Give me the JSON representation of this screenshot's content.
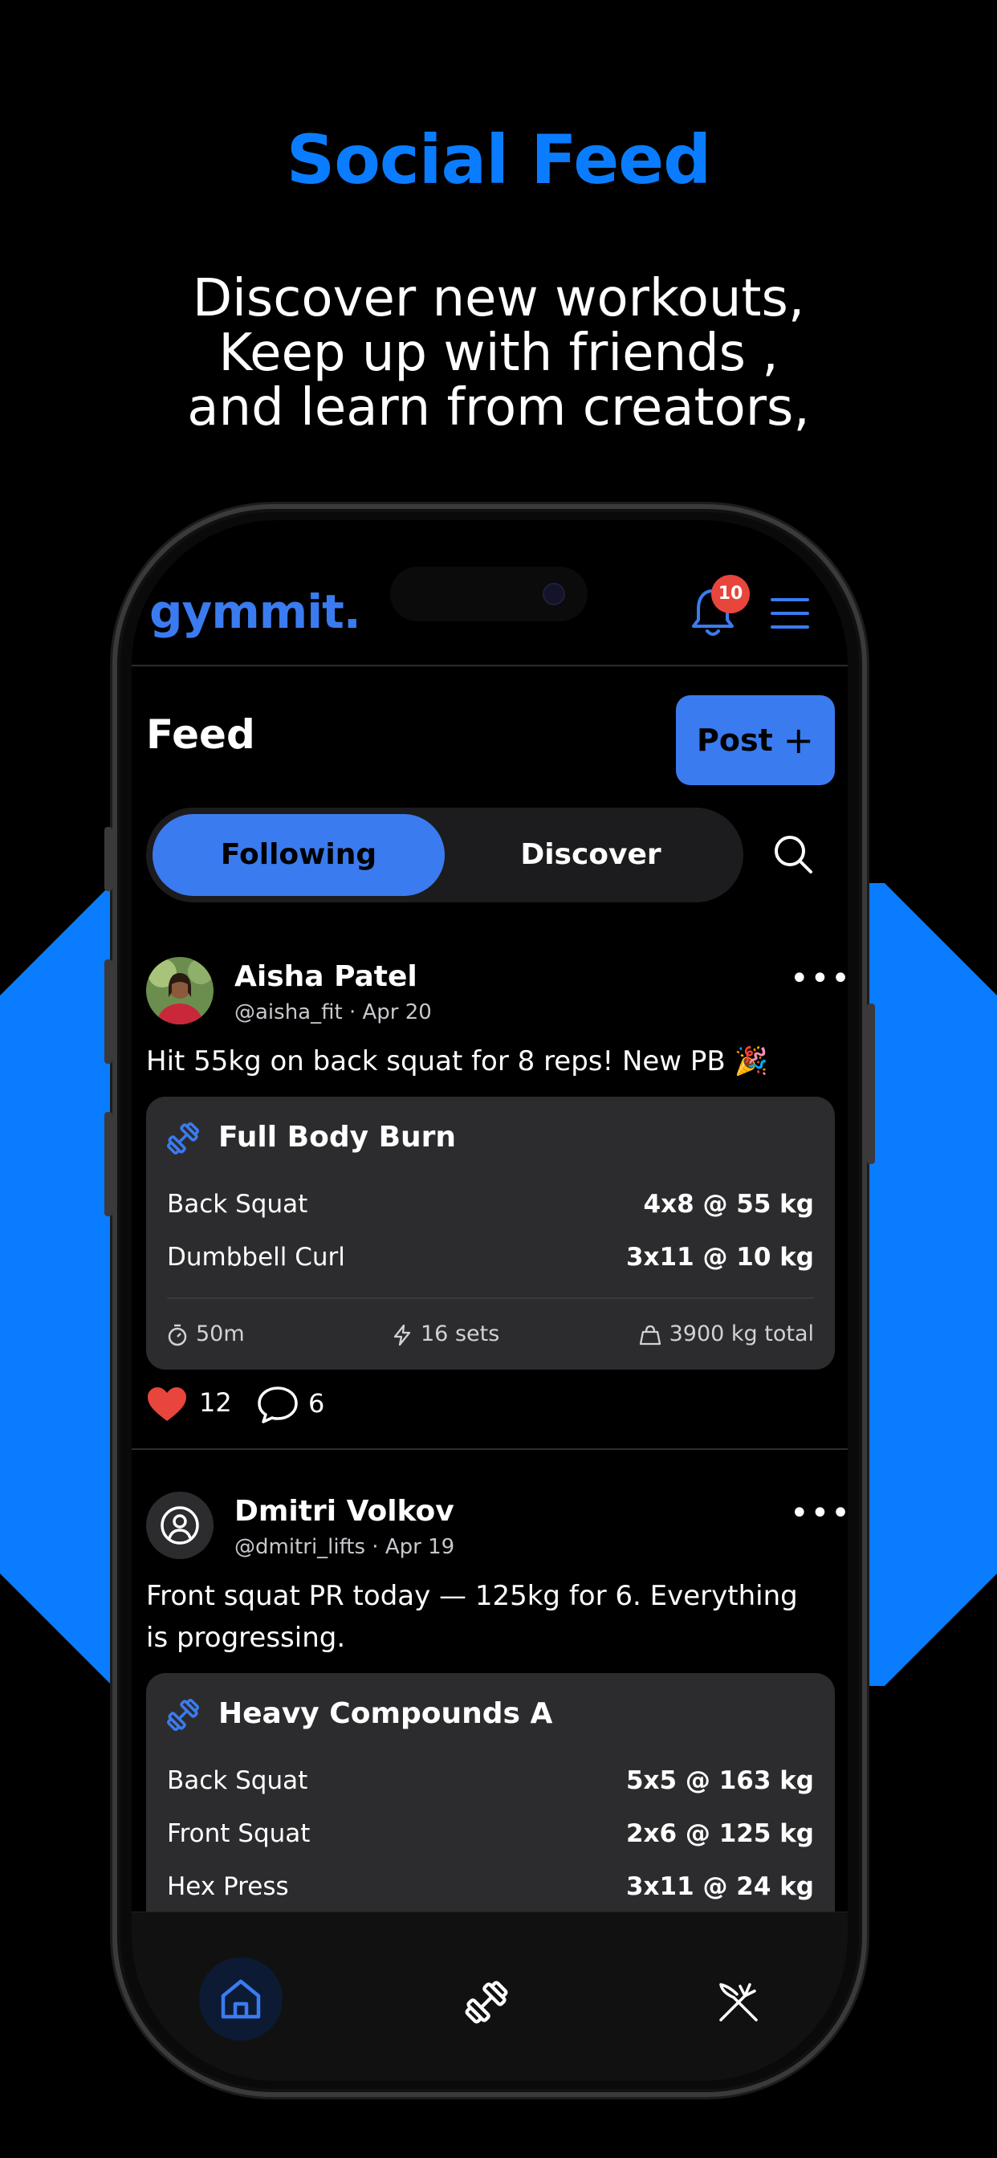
{
  "promo": {
    "headline": "Social Feed",
    "lines": [
      "Discover new workouts,",
      "Keep up with friends ,",
      "and learn from creators,"
    ]
  },
  "colors": {
    "accent": "#3b7bf0",
    "brand_blue": "#0a7cff",
    "like_red": "#e8453c"
  },
  "header": {
    "logo": "gymmit.",
    "notification_count": "10",
    "bell_icon": "bell-icon",
    "menu_icon": "hamburger-menu-icon"
  },
  "feed": {
    "title": "Feed",
    "post_label": "Post",
    "post_icon": "plus-icon",
    "tabs": [
      {
        "label": "Following",
        "selected": true
      },
      {
        "label": "Discover",
        "selected": false
      }
    ],
    "search_icon": "search-icon"
  },
  "posts": [
    {
      "name": "Aisha Patel",
      "meta": "@aisha_fit · Apr 20",
      "text": "Hit 55kg on back squat for 8 reps! New PB 🎉",
      "workout": {
        "title": "Full Body Burn",
        "exercises": [
          {
            "name": "Back Squat",
            "value": "4x8 @ 55 kg"
          },
          {
            "name": "Dumbbell Curl",
            "value": "3x11 @ 10 kg"
          }
        ],
        "stats": {
          "duration": "50m",
          "sets": "16 sets",
          "total": "3900 kg total"
        }
      },
      "likes": "12",
      "comments": "6"
    },
    {
      "name": "Dmitri Volkov",
      "meta": "@dmitri_lifts · Apr 19",
      "text": "Front squat PR today — 125kg for 6. Everything is progressing.",
      "workout": {
        "title": "Heavy Compounds A",
        "exercises": [
          {
            "name": "Back Squat",
            "value": "5x5 @ 163 kg"
          },
          {
            "name": "Front Squat",
            "value": "2x6 @ 125 kg"
          },
          {
            "name": "Hex Press",
            "value": "3x11 @ 24 kg"
          }
        ]
      }
    }
  ],
  "bottom_nav": [
    {
      "icon": "home-icon",
      "active": true
    },
    {
      "icon": "dumbbell-icon",
      "active": false
    },
    {
      "icon": "fork-knife-icon",
      "active": false
    }
  ]
}
